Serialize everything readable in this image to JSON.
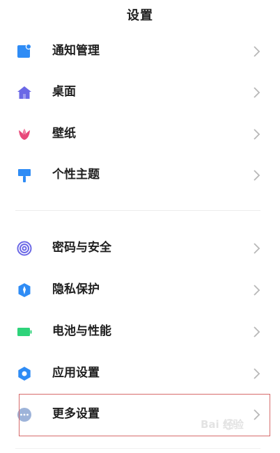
{
  "header": {
    "title": "设置"
  },
  "settings": {
    "items": [
      {
        "label": "通知管理",
        "icon": "notification-icon",
        "color": "#2f8cf5"
      },
      {
        "label": "桌面",
        "icon": "home-icon",
        "color": "#6b68e6"
      },
      {
        "label": "壁纸",
        "icon": "tulip-icon",
        "color": "#e8497a"
      },
      {
        "label": "个性主题",
        "icon": "paint-roller-icon",
        "color": "#2f8cf5"
      },
      {
        "label": "密码与安全",
        "icon": "fingerprint-icon",
        "color": "#6b68e6"
      },
      {
        "label": "隐私保护",
        "icon": "privacy-shield-icon",
        "color": "#2f8cf5"
      },
      {
        "label": "电池与性能",
        "icon": "battery-icon",
        "color": "#2ed37a"
      },
      {
        "label": "应用设置",
        "icon": "gear-icon",
        "color": "#2f8cf5"
      },
      {
        "label": "更多设置",
        "icon": "more-dots-icon",
        "color": "#9db3d9"
      }
    ]
  },
  "watermark": {
    "text": "Bai 经验"
  }
}
